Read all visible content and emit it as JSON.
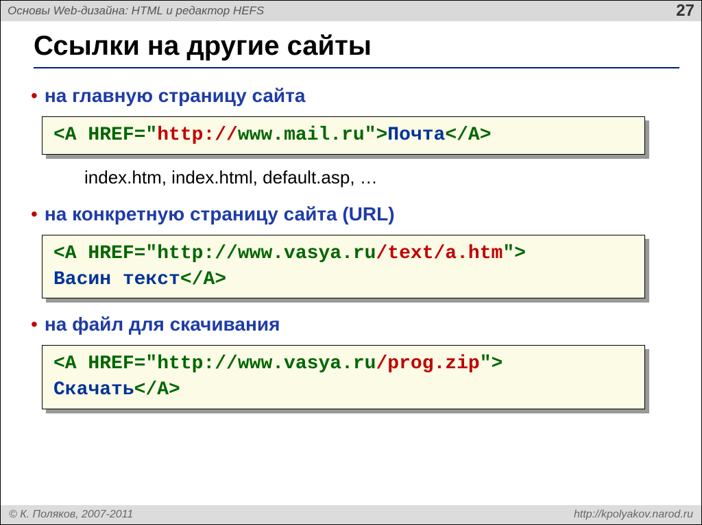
{
  "header": {
    "course": "Основы Web-дизайна: HTML и редактор HEFS",
    "page": "27"
  },
  "title": "Ссылки на другие сайты",
  "sections": [
    {
      "bullet": "на главную страницу сайта",
      "code": {
        "p0": "<A HREF=\"",
        "p1": "http://",
        "p2": "www.mail.ru\">",
        "p3": "Почта",
        "p4": "</A>"
      },
      "note": "index.htm, index.html, default.asp, …"
    },
    {
      "bullet": "на конкретную страницу сайта (URL)",
      "code": {
        "p0": "<A HREF=\"http://www.vasya.ru",
        "p1": "/text/a.htm",
        "p2": "\">",
        "p3": "Васин текст",
        "p4": "</A>"
      }
    },
    {
      "bullet": "на файл для скачивания",
      "code": {
        "p0": "<A HREF=\"http://www.vasya.ru",
        "p1": "/prog.zip",
        "p2": "\">",
        "p3": "Скачать",
        "p4": "</A>"
      }
    }
  ],
  "footer": {
    "left": "© К. Поляков, 2007-2011",
    "right": "http://kpolyakov.narod.ru"
  }
}
